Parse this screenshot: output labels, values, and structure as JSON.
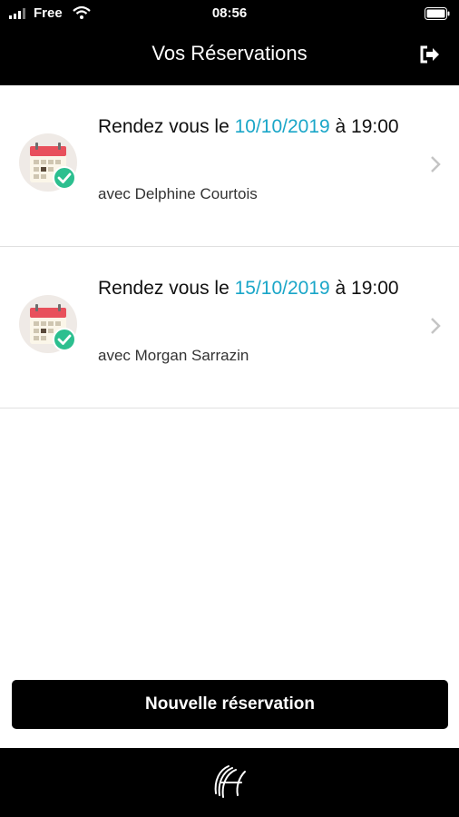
{
  "status_bar": {
    "carrier": "Free",
    "time": "08:56"
  },
  "header": {
    "title": "Vos Réservations",
    "logout_icon": "sign-out-icon"
  },
  "reservations": [
    {
      "prefix": "Rendez vous le ",
      "date": "10/10/2019",
      "suffix": " à 19:00",
      "with": "avec Delphine Courtois"
    },
    {
      "prefix": "Rendez vous le ",
      "date": "15/10/2019",
      "suffix": " à 19:00",
      "with": "avec Morgan Sarrazin"
    }
  ],
  "actions": {
    "new_reservation": "Nouvelle réservation"
  },
  "colors": {
    "accent": "#1aa6c8",
    "bar": "#000000",
    "calendar_red": "#e8505b",
    "check_green": "#2cbf8f"
  }
}
